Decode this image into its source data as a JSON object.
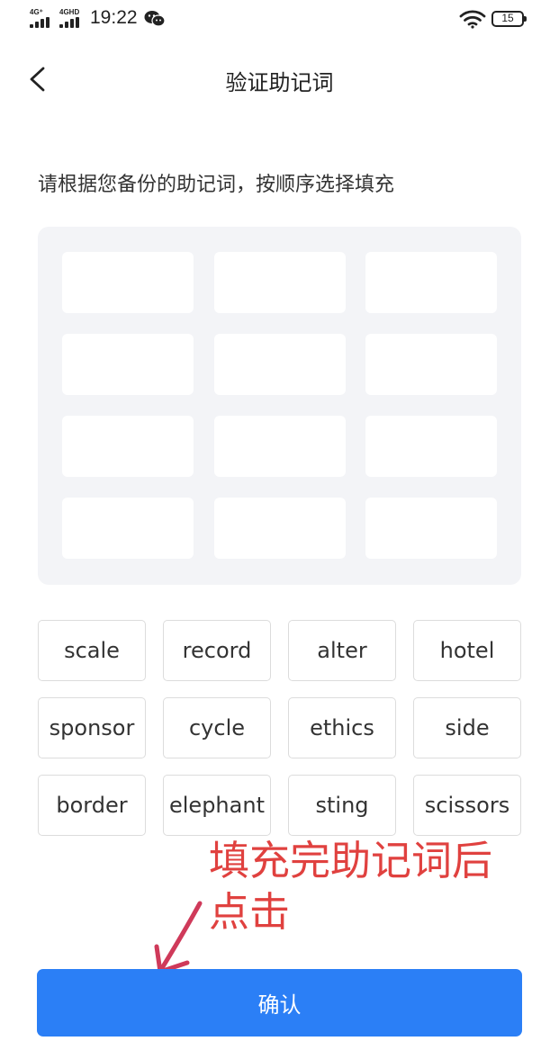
{
  "status_bar": {
    "signal_1_label": "4G⁺",
    "signal_2_label": "4GHD",
    "time": "19:22",
    "battery_level": "15"
  },
  "header": {
    "title": "验证助记词"
  },
  "instruction": "请根据您备份的助记词，按顺序选择填充",
  "slots": [
    "",
    "",
    "",
    "",
    "",
    "",
    "",
    "",
    "",
    "",
    "",
    ""
  ],
  "words": [
    "scale",
    "record",
    "alter",
    "hotel",
    "sponsor",
    "cycle",
    "ethics",
    "side",
    "border",
    "elephant",
    "sting",
    "scissors"
  ],
  "annotation": {
    "line1": "填充完助记词后",
    "line2": "点击"
  },
  "confirm_label": "确认",
  "colors": {
    "accent": "#2b7ff6",
    "annotation": "#e0413f",
    "panel": "#f3f4f7"
  }
}
